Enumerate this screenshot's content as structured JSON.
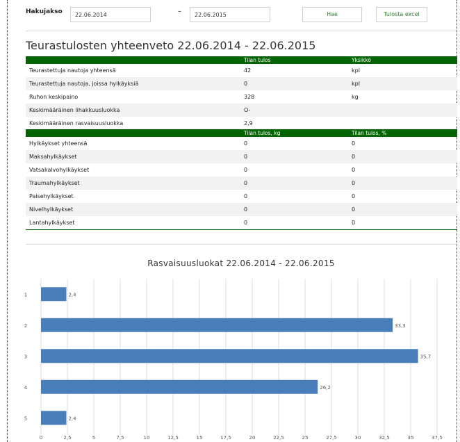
{
  "toolbar": {
    "period_label": "Hakujakso",
    "start_date": "22.06.2014",
    "separator": "–",
    "end_date": "22.06.2015",
    "search_button": "Hae",
    "excel_button": "Tulosta excel"
  },
  "summary": {
    "title": "Teurastulosten yhteenveto 22.06.2014 - 22.06.2015",
    "header1": [
      "",
      "Tilan tulos",
      "Yksikkö"
    ],
    "rows1": [
      [
        "Teurastettuja nautoja yhteensä",
        "42",
        "kpl"
      ],
      [
        "Teurastettuja nautoja, joissa hylkäyksiä",
        "0",
        "kpl"
      ],
      [
        "Ruhon keskipaino",
        "328",
        "kg"
      ],
      [
        "Keskimääräinen lihakkuusluokka",
        "O-",
        ""
      ],
      [
        "Keskimääräinen rasvaisuusluokka",
        "2,9",
        ""
      ]
    ],
    "header2": [
      "",
      "Tilan tulos, kg",
      "Tilan tulos, %"
    ],
    "rows2": [
      [
        "Hylkäykset yhteensä",
        "0",
        "0"
      ],
      [
        "Maksahylkäykset",
        "0",
        "0"
      ],
      [
        "Vatsakalvohylkäykset",
        "0",
        "0"
      ],
      [
        "Traumahylkäykset",
        "0",
        "0"
      ],
      [
        "Paisehylkäykset",
        "0",
        "0"
      ],
      [
        "Nivelhylkäykset",
        "0",
        "0"
      ],
      [
        "Lantahylkäykset",
        "0",
        "0"
      ]
    ]
  },
  "chart_data": {
    "type": "bar",
    "orientation": "horizontal",
    "title": "Rasvaisuusluokat 22.06.2014 - 22.06.2015",
    "categories": [
      "1",
      "2",
      "3",
      "4",
      "5"
    ],
    "values": [
      2.4,
      33.3,
      35.7,
      26.2,
      2.4
    ],
    "value_labels": [
      "2,4",
      "33,3",
      "35,7",
      "26,2",
      "2,4"
    ],
    "x_ticks": [
      "0",
      "2,5",
      "5",
      "7,5",
      "10",
      "12,5",
      "15",
      "17,5",
      "20",
      "22,5",
      "25",
      "27,5",
      "30",
      "32,5",
      "35",
      "37,5"
    ],
    "xlim": [
      0,
      37.5
    ],
    "grid": true,
    "bar_color": "#4a7ebb"
  }
}
